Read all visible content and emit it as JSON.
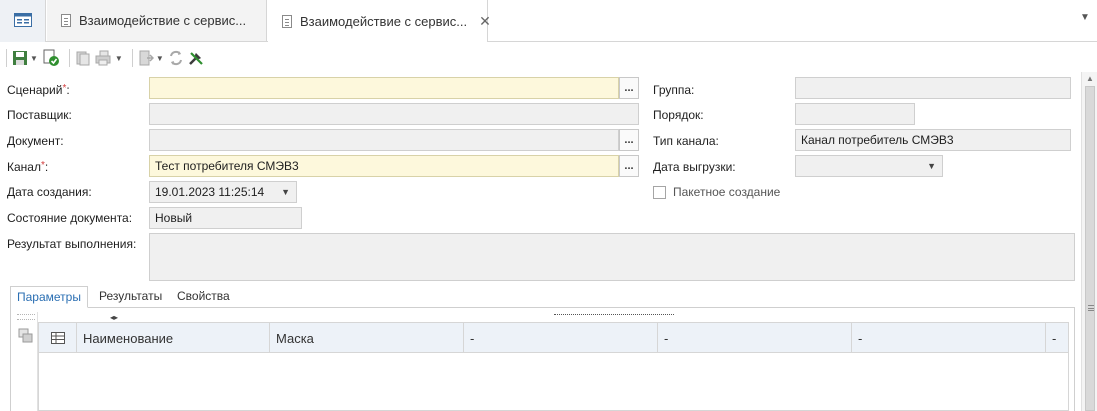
{
  "tabs": [
    {
      "label": "Взаимодействие с сервис...",
      "active": false
    },
    {
      "label": "Взаимодействие с сервис...",
      "active": true
    }
  ],
  "tab_close_glyph": "✕",
  "tabs_dropdown_glyph": "▼",
  "toolbar": {
    "icons": [
      "save-icon",
      "save-approve-icon",
      "copy-doc-icon",
      "print-icon",
      "send-icon",
      "refresh-icon",
      "settings-tools-icon"
    ]
  },
  "form": {
    "scenario": {
      "label": "Сценарий",
      "req": "*",
      "colon": ":",
      "value": ""
    },
    "supplier": {
      "label": "Поставщик:",
      "value": ""
    },
    "document": {
      "label": "Документ:",
      "value": ""
    },
    "channel": {
      "label": "Канал",
      "req": "*",
      "colon": ":",
      "value": "Тест потребителя СМЭВ3"
    },
    "created": {
      "label": "Дата создания:",
      "value": "19.01.2023 11:25:14"
    },
    "doc_state": {
      "label": "Состояние документа:",
      "value": "Новый"
    },
    "result": {
      "label": "Результат выполнения:",
      "value": ""
    },
    "group": {
      "label": "Группа:",
      "value": ""
    },
    "order": {
      "label": "Порядок:",
      "value": ""
    },
    "channel_type": {
      "label": "Тип канала:",
      "value": "Канал потребитель СМЭВ3"
    },
    "export_date": {
      "label": "Дата выгрузки:",
      "value": ""
    },
    "batch": {
      "label": "Пакетное создание",
      "checked": false
    }
  },
  "ellipsis_label": "...",
  "bottom_tabs": [
    {
      "label": "Параметры",
      "active": true
    },
    {
      "label": "Результаты",
      "active": false
    },
    {
      "label": "Свойства",
      "active": false
    }
  ],
  "grid": {
    "columns": [
      "Наименование",
      "Маска",
      "-",
      "-",
      "-",
      "-"
    ]
  },
  "colors": {
    "required_bg": "#fdf8dc",
    "readonly_bg": "#f0f0f0",
    "active_tab_text": "#2b6fb3",
    "grid_header_bg": "#edf2f8"
  }
}
